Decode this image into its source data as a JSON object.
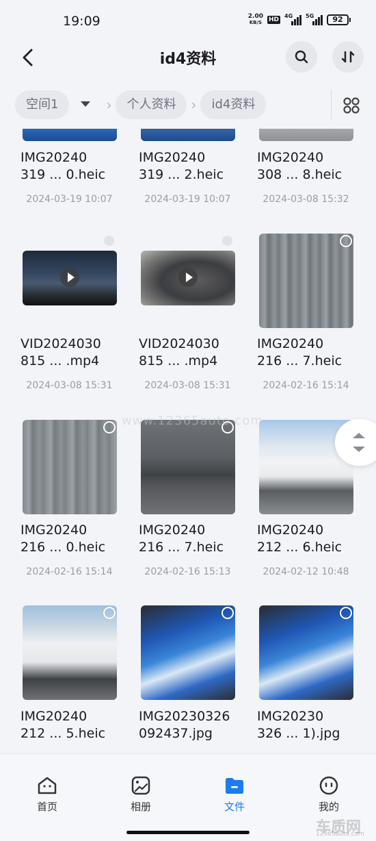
{
  "status_bar": {
    "time": "19:09",
    "net_speed_value": "2.00",
    "net_speed_unit": "KB/S",
    "hd_badge": "HD",
    "sig1_label": "4G",
    "sig2_label": "5G",
    "battery": "92"
  },
  "header": {
    "title": "id4资料",
    "back_icon": "back-arrow-icon",
    "search_icon": "search-icon",
    "sort_icon": "sort-icon"
  },
  "breadcrumb": {
    "root": "空间1",
    "items": [
      "个人资料",
      "id4资料"
    ],
    "view_toggle_icon": "grid-view-icon"
  },
  "files": [
    {
      "name_line1": "IMG20240",
      "name_line2": "319 ... 0.heic",
      "date": "2024-03-19 10:07",
      "kind": "image",
      "selector": "none"
    },
    {
      "name_line1": "IMG20240",
      "name_line2": "319 ... 2.heic",
      "date": "2024-03-19 10:07",
      "kind": "image",
      "selector": "none"
    },
    {
      "name_line1": "IMG20240",
      "name_line2": "308 ... 8.heic",
      "date": "2024-03-08 15:32",
      "kind": "image",
      "selector": "none"
    },
    {
      "name_line1": "VID2024030",
      "name_line2": "815 ... .mp4",
      "date": "2024-03-08 15:31",
      "kind": "video",
      "selector": "dot"
    },
    {
      "name_line1": "VID2024030",
      "name_line2": "815 ... .mp4",
      "date": "2024-03-08 15:31",
      "kind": "video",
      "selector": "dot"
    },
    {
      "name_line1": "IMG20240",
      "name_line2": "216 ... 7.heic",
      "date": "2024-02-16 15:14",
      "kind": "image",
      "selector": "circle"
    },
    {
      "name_line1": "IMG20240",
      "name_line2": "216 ... 0.heic",
      "date": "2024-02-16 15:14",
      "kind": "image",
      "selector": "circle"
    },
    {
      "name_line1": "IMG20240",
      "name_line2": "216 ... 7.heic",
      "date": "2024-02-16 15:13",
      "kind": "image",
      "selector": "circle"
    },
    {
      "name_line1": "IMG20240",
      "name_line2": "212 ... 6.heic",
      "date": "2024-02-12 10:48",
      "kind": "image",
      "selector": "circle"
    },
    {
      "name_line1": "IMG20240",
      "name_line2": "212 ... 5.heic",
      "date": "",
      "kind": "image",
      "selector": "circle"
    },
    {
      "name_line1": "IMG20230326",
      "name_line2": "092437.jpg",
      "date": "",
      "kind": "image",
      "selector": "circle"
    },
    {
      "name_line1": "IMG20230",
      "name_line2": "326 ... 1).jpg",
      "date": "",
      "kind": "image",
      "selector": "circle"
    }
  ],
  "watermark": "www.12365auto.com",
  "bottom_nav": [
    {
      "label": "首页",
      "icon": "home-icon",
      "active": false
    },
    {
      "label": "相册",
      "icon": "album-icon",
      "active": false
    },
    {
      "label": "文件",
      "icon": "folder-icon",
      "active": true
    },
    {
      "label": "我的",
      "icon": "profile-icon",
      "active": false
    }
  ],
  "brand_watermark": {
    "line1": "车质网",
    "line2": "12365auto.com"
  },
  "colors": {
    "accent": "#1a7cf0",
    "chip_bg": "#e6e8ee",
    "background": "#f3f4f8"
  }
}
